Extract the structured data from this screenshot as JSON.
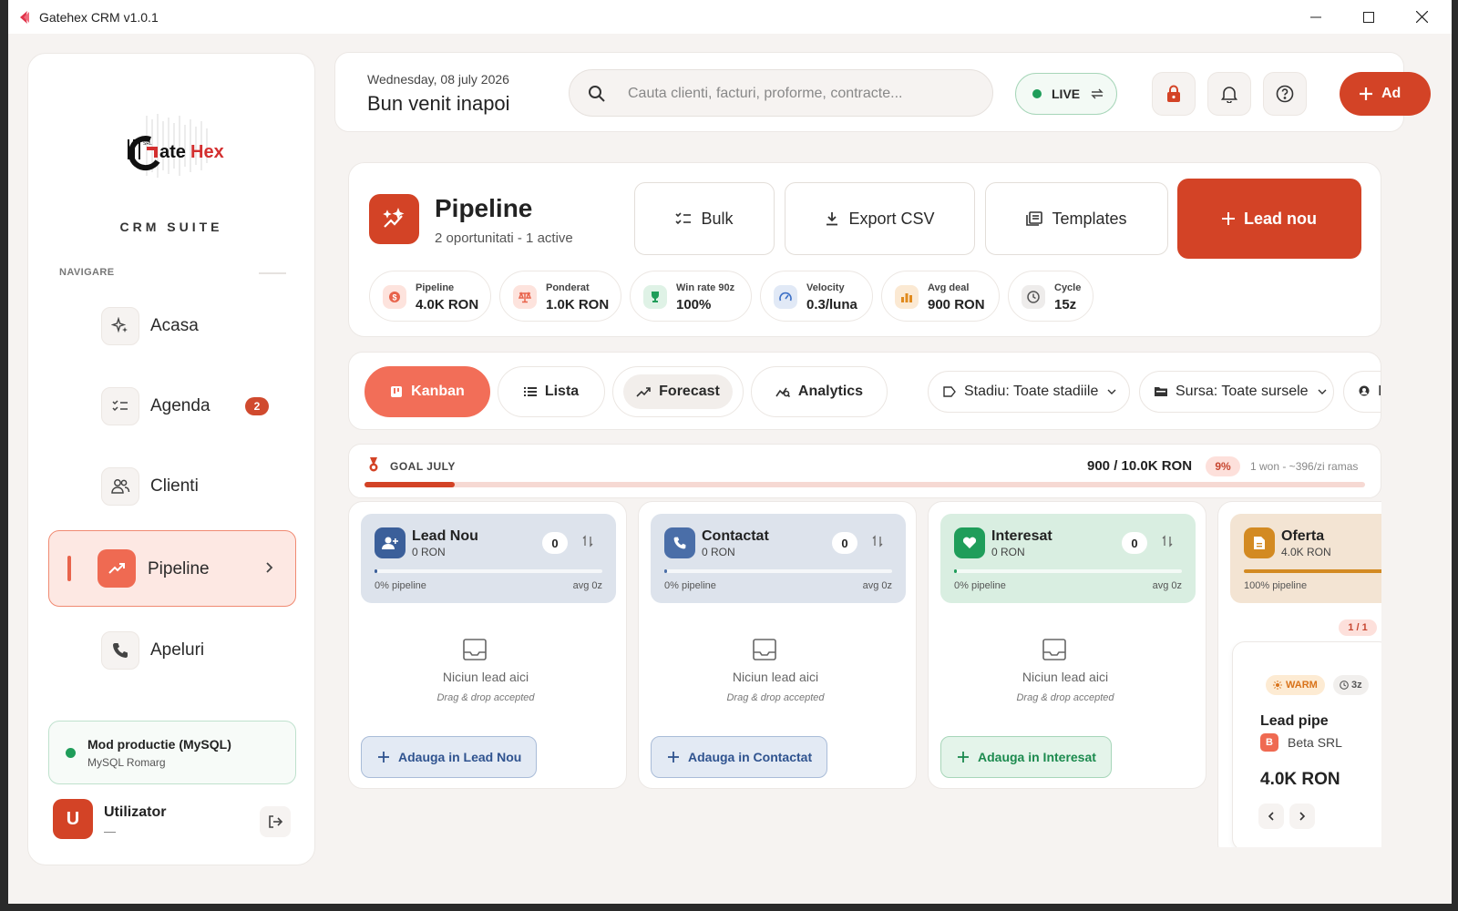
{
  "window": {
    "title": "Gatehex CRM v1.0.1"
  },
  "sidebar": {
    "suite": "CRM SUITE",
    "nav_label": "NAVIGARE",
    "items": [
      {
        "label": "Acasa",
        "icon": "sparkle-icon"
      },
      {
        "label": "Agenda",
        "icon": "checklist-icon",
        "badge": "2"
      },
      {
        "label": "Clienti",
        "icon": "users-icon"
      },
      {
        "label": "Pipeline",
        "icon": "trending-up-icon",
        "active": true
      },
      {
        "label": "Apeluri",
        "icon": "phone-icon"
      }
    ],
    "mode": {
      "title": "Mod productie (MySQL)",
      "subtitle": "MySQL Romarg"
    },
    "user": {
      "initial": "U",
      "name": "Utilizator",
      "sub": "—"
    }
  },
  "header": {
    "date": "Wednesday, 08 july 2026",
    "welcome": "Bun venit inapoi",
    "search_placeholder": "Cauta clienti, facturi, proforme, contracte...",
    "live_label": "LIVE",
    "add_label": "Ad"
  },
  "pipeline": {
    "title": "Pipeline",
    "subtitle": "2 oportunitati - 1 active",
    "actions": {
      "bulk": "Bulk",
      "export": "Export CSV",
      "templates": "Templates",
      "new_lead": "Lead nou"
    },
    "stats": [
      {
        "label": "Pipeline",
        "value": "4.0K RON",
        "color": "#e8634b"
      },
      {
        "label": "Ponderat",
        "value": "1.0K RON",
        "color": "#e8634b"
      },
      {
        "label": "Win rate 90z",
        "value": "100%",
        "color": "#1f9d5a"
      },
      {
        "label": "Velocity",
        "value": "0.3/luna",
        "color": "#3b6fc6"
      },
      {
        "label": "Avg deal",
        "value": "900 RON",
        "color": "#e08a1e"
      },
      {
        "label": "Cycle",
        "value": "15z",
        "color": "#666666"
      }
    ]
  },
  "tabs": [
    {
      "label": "Kanban",
      "active": true
    },
    {
      "label": "Lista"
    },
    {
      "label": "Forecast"
    },
    {
      "label": "Analytics"
    }
  ],
  "filters": {
    "stage": "Stadiu: Toate stadiile",
    "source": "Sursa: Toate sursele",
    "owner": "I"
  },
  "goal": {
    "label": "GOAL JULY",
    "value": "900 / 10.0K RON",
    "percent": "9%",
    "progress": 0.09,
    "remaining": "1 won - ~396/zi ramas"
  },
  "columns": [
    {
      "name": "Lead Nou",
      "value": "0 RON",
      "count": "0",
      "pipeline": "0% pipeline",
      "avg": "avg 0z",
      "fill": 0.01,
      "empty": "Niciun lead aici",
      "drop": "Drag & drop accepted",
      "add": "Adauga in Lead Nou",
      "bg": "#dde3ec",
      "accent": "#3b5f9a",
      "bar": "#8ea4c6"
    },
    {
      "name": "Contactat",
      "value": "0 RON",
      "count": "0",
      "pipeline": "0% pipeline",
      "avg": "avg 0z",
      "fill": 0.01,
      "empty": "Niciun lead aici",
      "drop": "Drag & drop accepted",
      "add": "Adauga in Contactat",
      "bg": "#dde3ec",
      "accent": "#4a6ea8",
      "bar": "#8ea4c6"
    },
    {
      "name": "Interesat",
      "value": "0 RON",
      "count": "0",
      "pipeline": "0% pipeline",
      "avg": "avg 0z",
      "fill": 0.01,
      "empty": "Niciun lead aici",
      "drop": "Drag & drop accepted",
      "add": "Adauga in Interesat",
      "bg": "#d9eee1",
      "accent": "#1f9d5a",
      "bar": "#8fcfaa"
    },
    {
      "name": "Oferta",
      "value": "4.0K RON",
      "pipeline": "100% pipeline",
      "fill": 1.0,
      "bg": "#f3e4d3",
      "accent": "#d38a22",
      "bar": "#d38a22",
      "pager": "1 / 1",
      "card": {
        "temp": "WARM",
        "age": "3z",
        "name": "Lead pipe",
        "company_initial": "B",
        "company": "Beta SRL",
        "value": "4.0K RON"
      }
    }
  ]
}
